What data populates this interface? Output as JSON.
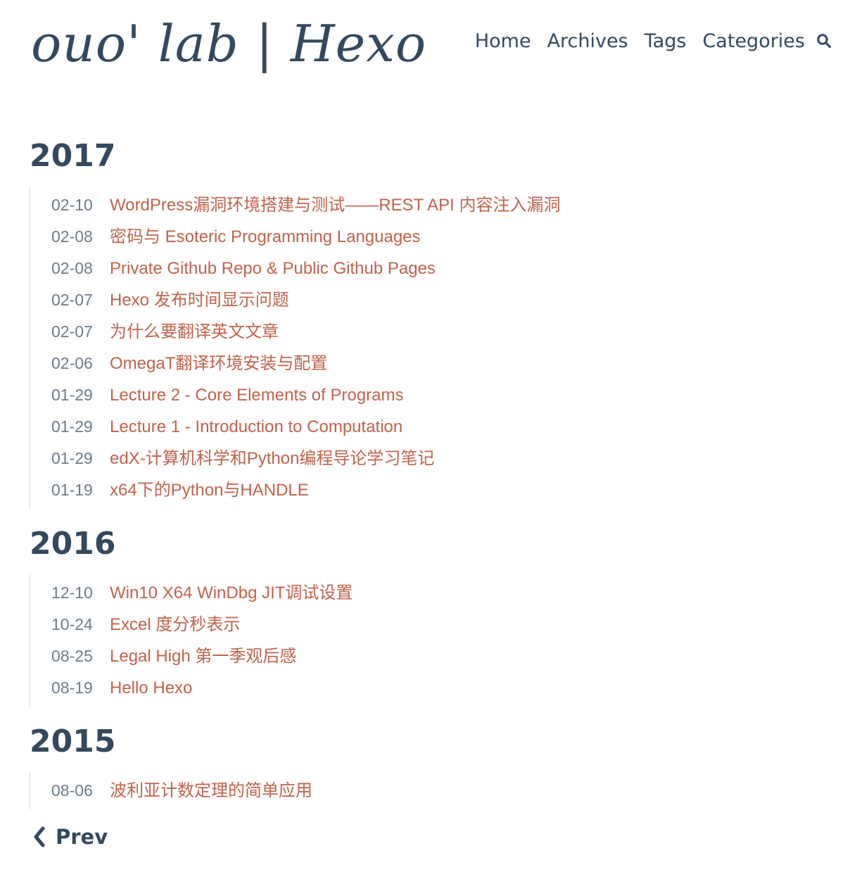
{
  "site": {
    "title": "ouo' lab | Hexo"
  },
  "nav": {
    "items": [
      "Home",
      "Archives",
      "Tags",
      "Categories"
    ],
    "search_icon": "search-icon"
  },
  "archive": {
    "years": [
      {
        "year": "2017",
        "posts": [
          {
            "date": "02-10",
            "title": "WordPress漏洞环境搭建与测试——REST API 内容注入漏洞"
          },
          {
            "date": "02-08",
            "title": "密码与 Esoteric Programming Languages"
          },
          {
            "date": "02-08",
            "title": "Private Github Repo & Public Github Pages"
          },
          {
            "date": "02-07",
            "title": "Hexo 发布时间显示问题"
          },
          {
            "date": "02-07",
            "title": "为什么要翻译英文文章"
          },
          {
            "date": "02-06",
            "title": "OmegaT翻译环境安装与配置"
          },
          {
            "date": "01-29",
            "title": "Lecture 2 - Core Elements of Programs"
          },
          {
            "date": "01-29",
            "title": "Lecture 1 - Introduction to Computation"
          },
          {
            "date": "01-29",
            "title": "edX-计算机科学和Python编程导论学习笔记"
          },
          {
            "date": "01-19",
            "title": "x64下的Python与HANDLE"
          }
        ]
      },
      {
        "year": "2016",
        "posts": [
          {
            "date": "12-10",
            "title": "Win10 X64 WinDbg JIT调试设置"
          },
          {
            "date": "10-24",
            "title": "Excel 度分秒表示"
          },
          {
            "date": "08-25",
            "title": "Legal High 第一季观后感"
          },
          {
            "date": "08-19",
            "title": "Hello Hexo"
          }
        ]
      },
      {
        "year": "2015",
        "posts": [
          {
            "date": "08-06",
            "title": "波利亚计数定理的简单应用"
          }
        ]
      }
    ]
  },
  "pagination": {
    "prev_label": "Prev",
    "prev_icon": "chevron-left-icon"
  },
  "colors": {
    "text": "#34495e",
    "link": "#c0624c",
    "date": "#6b7b8a"
  }
}
